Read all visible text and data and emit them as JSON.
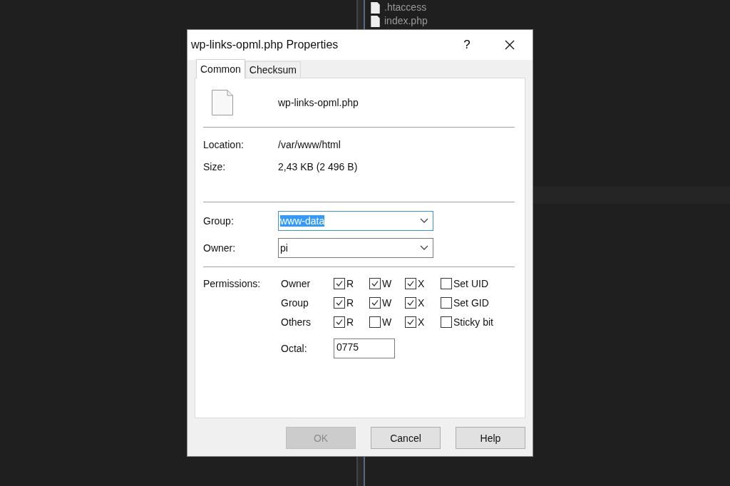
{
  "background": {
    "files": [
      {
        "name": ".htaccess"
      },
      {
        "name": "index.php"
      }
    ]
  },
  "dialog": {
    "title": "wp-links-opml.php Properties",
    "help_button": "?",
    "tabs": [
      {
        "label": "Common",
        "selected": true
      },
      {
        "label": "Checksum",
        "selected": false
      }
    ],
    "file_name": "wp-links-opml.php",
    "info": [
      {
        "label": "Location:",
        "value": "/var/www/html"
      },
      {
        "label": "Size:",
        "value": "2,43 KB (2 496 B)"
      }
    ],
    "dropdowns": [
      {
        "label": "Group:",
        "value": "www-data",
        "selected": true
      },
      {
        "label": "Owner:",
        "value": "pi",
        "selected": false
      }
    ],
    "permissions": {
      "label": "Permissions:",
      "rows": [
        {
          "label": "Owner",
          "bits": [
            {
              "label": "R",
              "checked": true
            },
            {
              "label": "W",
              "checked": true
            },
            {
              "label": "X",
              "checked": true
            },
            {
              "label": "Set UID",
              "checked": false
            }
          ]
        },
        {
          "label": "Group",
          "bits": [
            {
              "label": "R",
              "checked": true
            },
            {
              "label": "W",
              "checked": true
            },
            {
              "label": "X",
              "checked": true
            },
            {
              "label": "Set GID",
              "checked": false
            }
          ]
        },
        {
          "label": "Others",
          "bits": [
            {
              "label": "R",
              "checked": true
            },
            {
              "label": "W",
              "checked": false
            },
            {
              "label": "X",
              "checked": true
            },
            {
              "label": "Sticky bit",
              "checked": false
            }
          ]
        }
      ],
      "octal_label": "Octal:",
      "octal": "0775"
    },
    "buttons": [
      {
        "label": "OK",
        "disabled": true
      },
      {
        "label": "Cancel",
        "disabled": false
      },
      {
        "label": "Help",
        "disabled": false
      }
    ]
  }
}
